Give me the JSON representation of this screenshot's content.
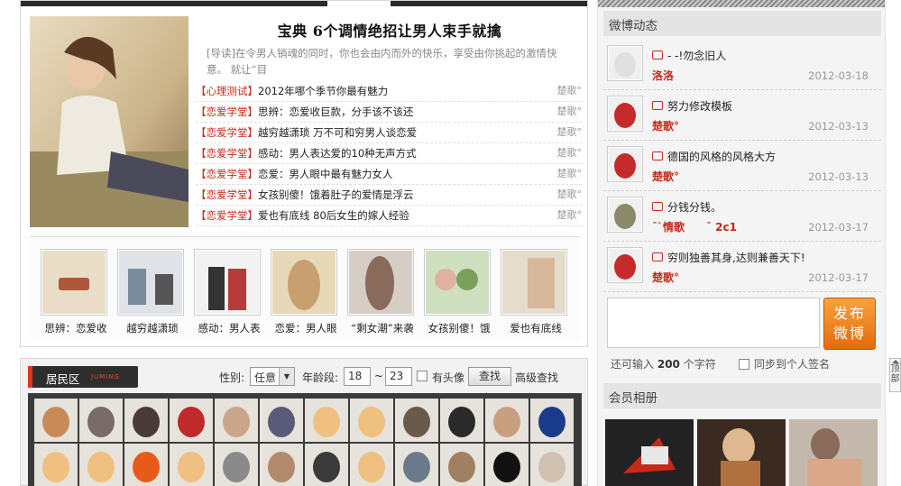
{
  "feature": {
    "headline": "宝典 6个调情绝招让男人束手就擒",
    "lede": "[导读]在令男人销魂的同时，你也会由内而外的快乐，享受由你挑起的激情快意。 就让“目"
  },
  "articles": [
    {
      "category": "【心理测试】",
      "title": "2012年哪个季节你最有魅力",
      "author": "楚歌°"
    },
    {
      "category": "【恋爱学堂】",
      "title": "思辨：恋爱收巨款，分手该不该还",
      "author": "楚歌°"
    },
    {
      "category": "【恋爱学堂】",
      "title": "越穷越潇琐 万不可和穷男人谈恋爱",
      "author": "楚歌°"
    },
    {
      "category": "【恋爱学堂】",
      "title": "感动：男人表达爱的10种无声方式",
      "author": "楚歌°"
    },
    {
      "category": "【恋爱学堂】",
      "title": "恋爱：男人眼中最有魅力女人",
      "author": "楚歌°"
    },
    {
      "category": "【恋爱学堂】",
      "title": "女孩别傻！饿着肚子的爱情是浮云",
      "author": "楚歌°"
    },
    {
      "category": "【恋爱学堂】",
      "title": "爱也有底线 80后女生的嫁人经验",
      "author": "楚歌°"
    }
  ],
  "thumbs": [
    {
      "caption": "思辨：恋爱收",
      "color": "#b0563a"
    },
    {
      "caption": "越穷越潇琐",
      "color": "#7a8a9a"
    },
    {
      "caption": "感动：男人表",
      "color": "#b93a3a"
    },
    {
      "caption": "恋爱：男人眼",
      "color": "#c8a070"
    },
    {
      "caption": "“剩女潮”来袭",
      "color": "#8a6a5a"
    },
    {
      "caption": "女孩别傻！饿",
      "color": "#7aa05a"
    },
    {
      "caption": "爱也有底线",
      "color": "#d8b89a"
    }
  ],
  "residents": {
    "tab_label": "居民区",
    "tab_sub": "JUMING",
    "gender_label": "性别:",
    "gender_value": "任意",
    "age_label": "年龄段:",
    "age_from": "18",
    "age_sep": "~",
    "age_to": "23",
    "has_avatar_label": "有头像",
    "search_button": "查找",
    "advanced_search": "高级查找",
    "avatar_colors_row1": [
      "#c98a5a",
      "#7a6a6a",
      "#4a3a3a",
      "#c02a2a",
      "#caa58a",
      "#5a5a7a",
      "#f0c080",
      "#f0c080",
      "#6a5a4a",
      "#2a2a2a",
      "#c8a080",
      "#1a3a8a"
    ],
    "avatar_colors_row2": [
      "#f0c080",
      "#f0c080",
      "#e85a1a",
      "#f0c080",
      "#8a8a8a",
      "#b08a6a",
      "#3a3a3a",
      "#f0c080",
      "#6a7a8a",
      "#a08060",
      "#111111",
      "#d0c0b0"
    ]
  },
  "sidebar": {
    "weibo_title": "微博动态",
    "feed": [
      {
        "message": "- -!勿念旧人",
        "user": "洛洛",
        "date": "2012-03-18",
        "avatar_color": "#e0e0e0"
      },
      {
        "message": "努力修改模板",
        "user": "楚歌°",
        "date": "2012-03-13",
        "avatar_color": "#c62a2a"
      },
      {
        "message": "德国的风格的风格大方",
        "user": "楚歌°",
        "date": "2012-03-13",
        "avatar_color": "#c62a2a"
      },
      {
        "message": "分钱分钱。",
        "user": "ˉ`情歌　　ˉ 2c1",
        "date": "2012-03-17",
        "avatar_color": "#8a8a6a"
      },
      {
        "message": "穷则独善其身,达则兼善天下!",
        "user": "楚歌°",
        "date": "2012-03-17",
        "avatar_color": "#c62a2a"
      }
    ],
    "post_button": "发布微博",
    "post_button_line1": "发布",
    "post_button_line2": "微博",
    "remaining_prefix": "还可输入",
    "remaining_count": "200",
    "remaining_suffix": "个字符",
    "sync_label": "同步到个人签名",
    "album_title": "会员相册",
    "albums": [
      {
        "color": "#222222"
      },
      {
        "color": "#b07040"
      },
      {
        "color": "#8a6a5a"
      }
    ]
  },
  "to_top": "顶部"
}
